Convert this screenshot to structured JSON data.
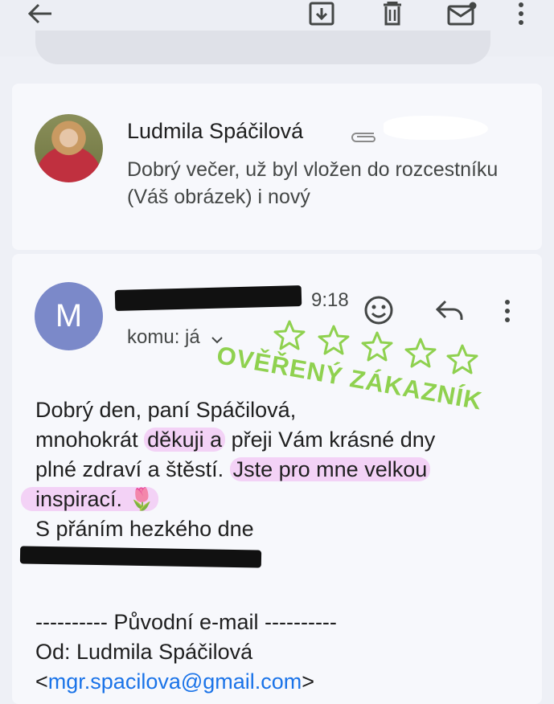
{
  "topbar": {
    "icons": [
      "back-arrow-icon",
      "archive-icon",
      "delete-icon",
      "mark-unread-icon",
      "more-vert-icon"
    ]
  },
  "thread_item": {
    "sender": "Ludmila Spáčilová",
    "snippet": "Dobrý večer, už byl vložen do rozcestníku (Váš obrázek) i nový",
    "attachment_icon": "paperclip-icon"
  },
  "message": {
    "avatar_letter": "M",
    "time": "9:18",
    "to_label": "komu: já",
    "stamp_text": "OVĚŘENÝ ZÁKAZNÍK",
    "stamp_color": "#8fd14f",
    "body": {
      "greeting": "Dobrý den, paní Spáčilová,",
      "line2_pre": "mnohokrát ",
      "line2_hl": "děkuji a",
      "line2_post": " přeji Vám krásné dny",
      "line3_pre": "plné zdraví a štěstí. ",
      "line3_hl": "Jste pro mne velkou",
      "line4_hl": "inspirací. 🌷",
      "line5": "S přáním hezkého dne"
    },
    "original_header": "---------- Původní e-mail ----------",
    "from_line": "Od: Ludmila Spáčilová",
    "email_open": "<",
    "email": "mgr.spacilova@gmail.com",
    "email_close": ">"
  }
}
